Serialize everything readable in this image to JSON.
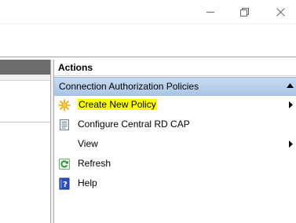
{
  "actions": {
    "title": "Actions",
    "section_label": "Connection Authorization Policies",
    "items": [
      {
        "label": "Create New Policy",
        "icon": "sunburst-icon",
        "submenu": true,
        "highlighted": true
      },
      {
        "label": "Configure Central RD CAP",
        "icon": "server-config-icon",
        "submenu": false
      },
      {
        "label": "View",
        "icon": "",
        "submenu": true
      },
      {
        "label": "Refresh",
        "icon": "refresh-icon",
        "submenu": false
      },
      {
        "label": "Help",
        "icon": "help-book-icon",
        "submenu": false
      }
    ]
  },
  "colors": {
    "section_header": "#b8d0ea",
    "highlight": "#ffff00",
    "left_header": "#6c6c6c"
  }
}
